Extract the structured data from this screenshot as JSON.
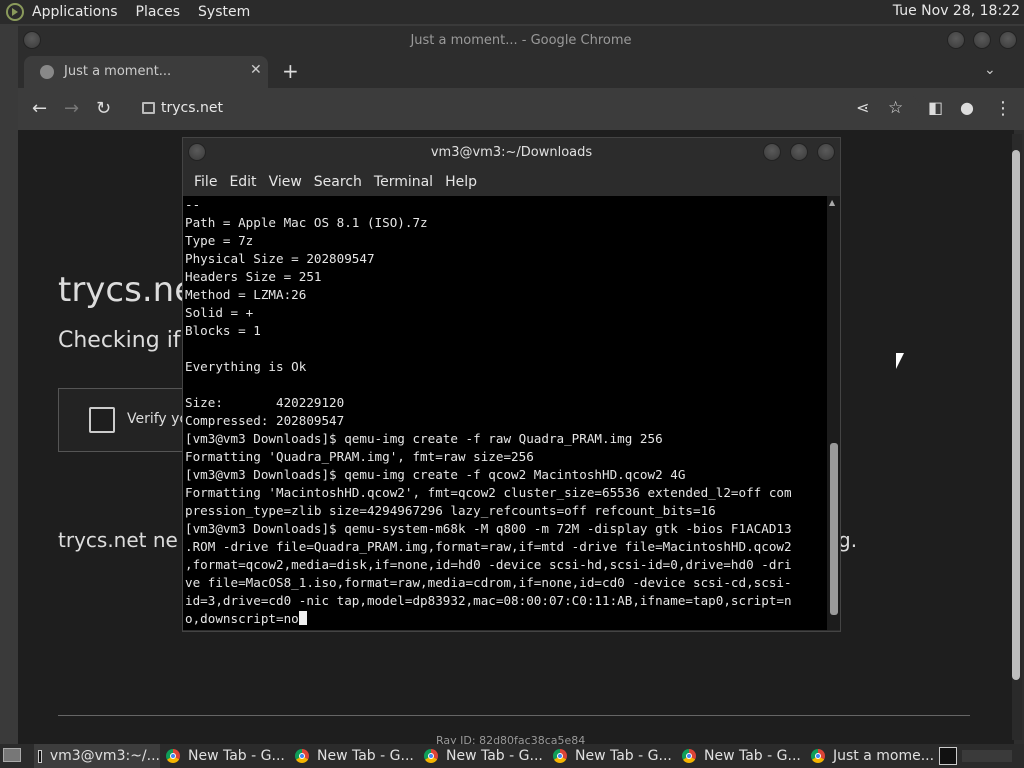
{
  "top_panel": {
    "menus": [
      "Applications",
      "Places",
      "System"
    ],
    "clock": "Tue Nov 28, 18:22"
  },
  "chrome": {
    "window_title": "Just a moment... - Google Chrome",
    "tab_title": "Just a moment...",
    "url": "trycs.net"
  },
  "page": {
    "heading": "trycs.ne",
    "checking": "Checking if",
    "verify_label": "Verify you a",
    "info": "trycs.net ne",
    "info_tail": "g.",
    "ray_id": "Ray ID: 82d80fac38ca5e84"
  },
  "terminal": {
    "title": "vm3@vm3:~/Downloads",
    "menu": [
      "File",
      "Edit",
      "View",
      "Search",
      "Terminal",
      "Help"
    ],
    "lines": [
      "--",
      "Path = Apple Mac OS 8.1 (ISO).7z",
      "Type = 7z",
      "Physical Size = 202809547",
      "Headers Size = 251",
      "Method = LZMA:26",
      "Solid = +",
      "Blocks = 1",
      "",
      "Everything is Ok",
      "",
      "Size:       420229120",
      "Compressed: 202809547",
      "[vm3@vm3 Downloads]$ qemu-img create -f raw Quadra_PRAM.img 256",
      "Formatting 'Quadra_PRAM.img', fmt=raw size=256",
      "[vm3@vm3 Downloads]$ qemu-img create -f qcow2 MacintoshHD.qcow2 4G",
      "Formatting 'MacintoshHD.qcow2', fmt=qcow2 cluster_size=65536 extended_l2=off com",
      "pression_type=zlib size=4294967296 lazy_refcounts=off refcount_bits=16",
      "[vm3@vm3 Downloads]$ qemu-system-m68k -M q800 -m 72M -display gtk -bios F1ACAD13",
      ".ROM -drive file=Quadra_PRAM.img,format=raw,if=mtd -drive file=MacintoshHD.qcow2",
      ",format=qcow2,media=disk,if=none,id=hd0 -device scsi-hd,scsi-id=0,drive=hd0 -dri",
      "ve file=MacOS8_1.iso,format=raw,media=cdrom,if=none,id=cd0 -device scsi-cd,scsi-",
      "id=3,drive=cd0 -nic tap,model=dp83932,mac=08:00:07:C0:11:AB,ifname=tap0,script=n",
      "o,downscript=no"
    ]
  },
  "taskbar": {
    "items": [
      {
        "label": "vm3@vm3:~/...",
        "icon": "terminal-icon"
      },
      {
        "label": "New Tab - G...",
        "icon": "chrome-icon"
      },
      {
        "label": "New Tab - G...",
        "icon": "chrome-icon"
      },
      {
        "label": "New Tab - G...",
        "icon": "chrome-icon"
      },
      {
        "label": "New Tab - G...",
        "icon": "chrome-icon"
      },
      {
        "label": "New Tab - G...",
        "icon": "chrome-icon"
      },
      {
        "label": "Just a mome...",
        "icon": "chrome-icon"
      }
    ]
  }
}
